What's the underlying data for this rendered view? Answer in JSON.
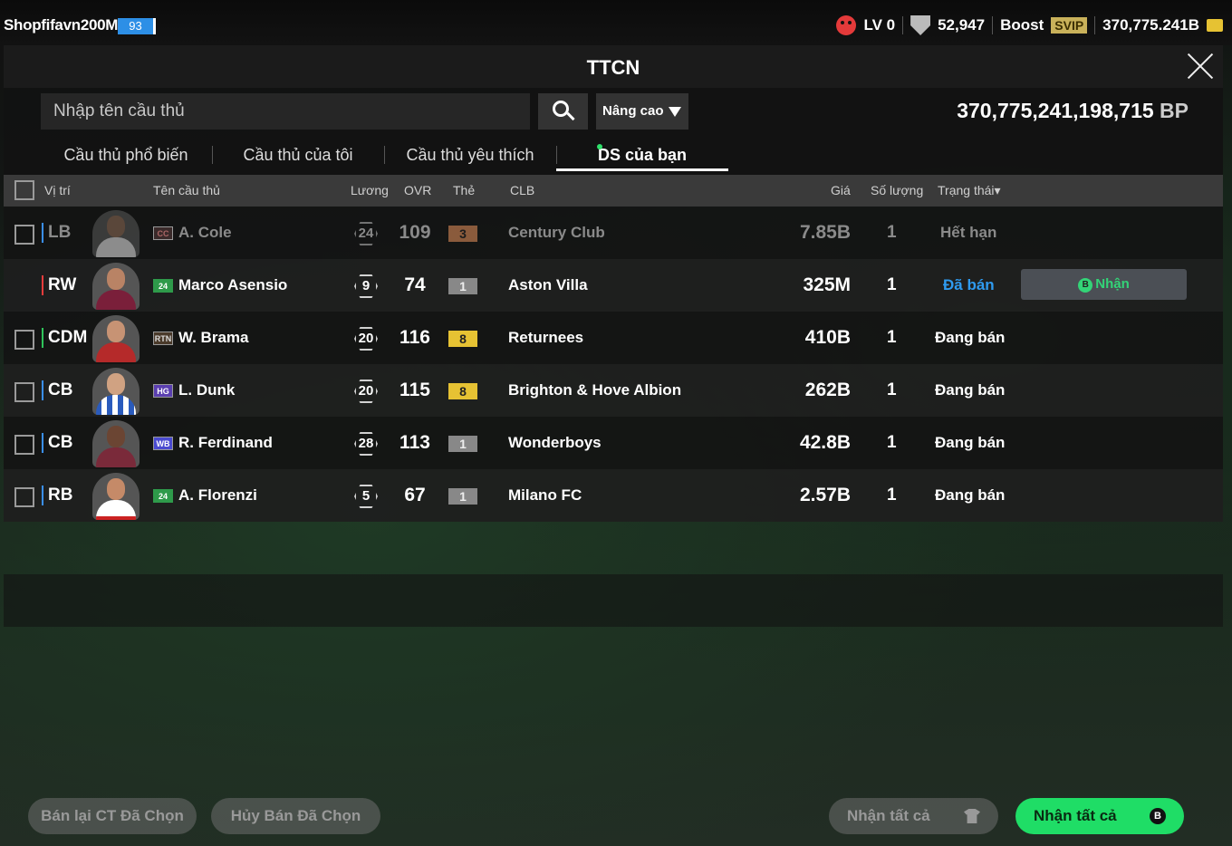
{
  "topbar": {
    "username": "Shopfifavn200M",
    "level_badge": "93",
    "lv": "LV 0",
    "points": "52,947",
    "boost": "Boost",
    "svip": "SVIP",
    "coins": "370,775.241B"
  },
  "window": {
    "title": "TTCN",
    "search_placeholder": "Nhập tên cầu thủ",
    "advanced_label": "Nâng cao",
    "bp_value": "370,775,241,198,715",
    "bp_unit": "BP",
    "tabs": [
      {
        "label": "Cầu thủ phổ biến"
      },
      {
        "label": "Cầu thủ của tôi"
      },
      {
        "label": "Cầu thủ yêu thích"
      },
      {
        "label": "DS của bạn"
      }
    ]
  },
  "table": {
    "headers": {
      "position": "Vị trí",
      "name": "Tên cầu thủ",
      "wage": "Lương",
      "ovr": "OVR",
      "grade": "Thẻ",
      "club": "CLB",
      "price": "Giá",
      "qty": "Số lượng",
      "status": "Trạng thái▾"
    },
    "rows": [
      {
        "pos": "LB",
        "season": "CC",
        "name": "A. Cole",
        "wage": "24",
        "ovr": "109",
        "grade": "3",
        "club": "Century Club",
        "price": "7.85B",
        "qty": "1",
        "status": "Hết hạn"
      },
      {
        "pos": "RW",
        "season": "24",
        "name": "Marco Asensio",
        "wage": "9",
        "ovr": "74",
        "grade": "1",
        "club": "Aston Villa",
        "price": "325M",
        "qty": "1",
        "status": "Đã bán",
        "action": "Nhận"
      },
      {
        "pos": "CDM",
        "season": "RTN",
        "name": "W. Brama",
        "wage": "20",
        "ovr": "116",
        "grade": "8",
        "club": "Returnees",
        "price": "410B",
        "qty": "1",
        "status": "Đang bán"
      },
      {
        "pos": "CB",
        "season": "HG",
        "name": "L. Dunk",
        "wage": "20",
        "ovr": "115",
        "grade": "8",
        "club": "Brighton & Hove Albion",
        "price": "262B",
        "qty": "1",
        "status": "Đang bán"
      },
      {
        "pos": "CB",
        "season": "WB",
        "name": "R. Ferdinand",
        "wage": "28",
        "ovr": "113",
        "grade": "1",
        "club": "Wonderboys",
        "price": "42.8B",
        "qty": "1",
        "status": "Đang bán"
      },
      {
        "pos": "RB",
        "season": "24",
        "name": "A. Florenzi",
        "wage": "5",
        "ovr": "67",
        "grade": "1",
        "club": "Milano FC",
        "price": "2.57B",
        "qty": "1",
        "status": "Đang bán"
      }
    ]
  },
  "bottom": {
    "resell_selected": "Bán lại CT Đã Chọn",
    "cancel_selected": "Hủy Bán Đã Chọn",
    "claim_all_grey": "Nhận tất cả",
    "claim_all_green": "Nhận tất cả"
  },
  "icons": {
    "b_coin": "B"
  }
}
